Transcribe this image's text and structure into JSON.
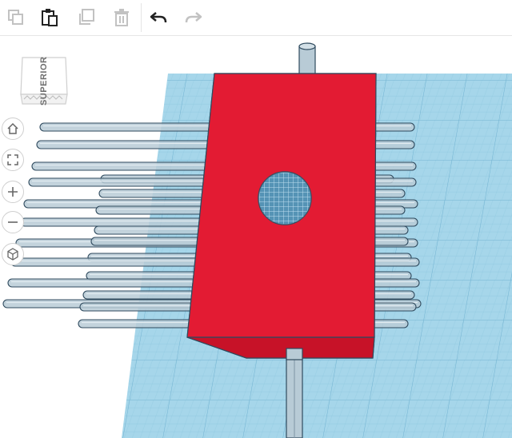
{
  "toolbar": {
    "buttons": [
      {
        "name": "copy",
        "icon": "copy-icon",
        "enabled": false
      },
      {
        "name": "paste",
        "icon": "paste-icon",
        "enabled": true
      },
      {
        "name": "duplicate",
        "icon": "duplicate-icon",
        "enabled": false
      },
      {
        "name": "delete",
        "icon": "trash-icon",
        "enabled": false
      },
      {
        "name": "undo",
        "icon": "undo-arrow-icon",
        "enabled": true
      },
      {
        "name": "redo",
        "icon": "redo-arrow-icon",
        "enabled": false
      }
    ]
  },
  "viewcube": {
    "face_label": "SUPERIOR"
  },
  "view_controls": [
    {
      "name": "home-view",
      "icon": "home-icon"
    },
    {
      "name": "fit-view",
      "icon": "fit-frame-icon"
    },
    {
      "name": "zoom-in",
      "icon": "plus-icon"
    },
    {
      "name": "zoom-out",
      "icon": "minus-icon"
    },
    {
      "name": "ortho-view",
      "icon": "cube-icon"
    }
  ],
  "colors": {
    "workplane": "#a6d6ea",
    "grid_line": "#8cc6de",
    "box_fill": "#e31b33",
    "box_side": "#c71228",
    "cylinder_fill": "#b8cbd6",
    "outline": "#2f4a5e",
    "icon_dark": "#222222",
    "icon_disabled": "#c2c2c2"
  }
}
